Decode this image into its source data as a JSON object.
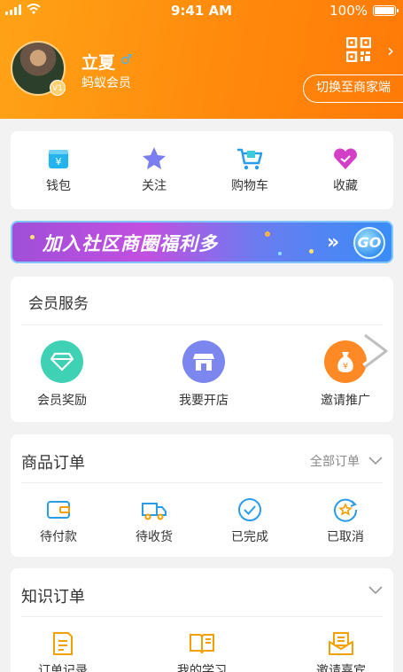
{
  "status": {
    "time": "9:41 AM",
    "battery": "100%"
  },
  "profile": {
    "name": "立夏",
    "gender_icon": "male-icon",
    "level": "蚂蚁会员",
    "vip_badge": "V1",
    "qr_icon": "qr-code-icon",
    "switch_label": "切换至商家端"
  },
  "quick_actions": [
    {
      "label": "钱包",
      "icon": "wallet-icon",
      "color": "#23b4f0"
    },
    {
      "label": "关注",
      "icon": "star-icon",
      "color": "#7a7ef0"
    },
    {
      "label": "购物车",
      "icon": "cart-icon",
      "color": "#2a9de8"
    },
    {
      "label": "收藏",
      "icon": "heart-icon",
      "color": "#d33fc7"
    }
  ],
  "banner": {
    "text": "加入社区商圈福利多",
    "go_label": "GO"
  },
  "member_services": {
    "title": "会员服务",
    "items": [
      {
        "label": "会员奖励",
        "icon": "diamond-icon",
        "color": "#3ed1b4"
      },
      {
        "label": "我要开店",
        "icon": "store-icon",
        "color": "#7b86ef"
      },
      {
        "label": "邀请推广",
        "icon": "money-bag-icon",
        "color": "#ff8a25"
      }
    ]
  },
  "goods_orders": {
    "title": "商品订单",
    "all_label": "全部订单",
    "items": [
      {
        "label": "待付款",
        "icon": "wallet-outline-icon"
      },
      {
        "label": "待收货",
        "icon": "truck-icon"
      },
      {
        "label": "已完成",
        "icon": "check-circle-icon"
      },
      {
        "label": "已取消",
        "icon": "cancel-star-icon"
      }
    ]
  },
  "knowledge_orders": {
    "title": "知识订单",
    "items": [
      {
        "label": "订单记录",
        "icon": "order-record-icon"
      },
      {
        "label": "我的学习",
        "icon": "book-icon"
      },
      {
        "label": "邀请嘉宾",
        "icon": "invite-envelope-icon"
      }
    ]
  },
  "colors": {
    "header": "#ff8a0c",
    "accent_blue": "#2a9de8",
    "icon_orange": "#f5a000"
  }
}
